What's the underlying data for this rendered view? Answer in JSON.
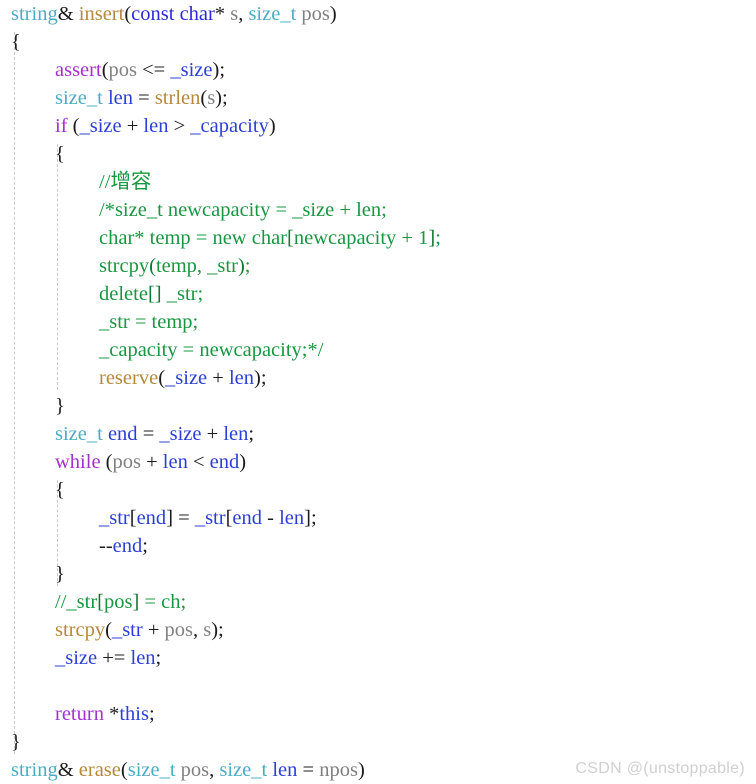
{
  "editor": {
    "language": "cpp",
    "background": "#ffffff",
    "indent_guide_color": "#c9c9c9",
    "font_size_px": 20.5,
    "line_height_px": 28
  },
  "palette": {
    "plain": "#1c1c1c",
    "type": "#4bacc6",
    "keyword": "#2b2bd6",
    "control": "#a331cf",
    "function": "#b5893d",
    "variable": "#2b3fd6",
    "parameter": "#808080",
    "comment": "#1a9641",
    "watermark": "#d0d0d0"
  },
  "watermark": {
    "text": "CSDN @(unstoppable)"
  },
  "code": {
    "lines": [
      {
        "n": 1,
        "tokens": [
          {
            "t": "string",
            "c": "type"
          },
          {
            "t": "& ",
            "c": "plain"
          },
          {
            "t": "insert",
            "c": "fn"
          },
          {
            "t": "(",
            "c": "punct"
          },
          {
            "t": "const ",
            "c": "kw"
          },
          {
            "t": "char",
            "c": "kw"
          },
          {
            "t": "* ",
            "c": "plain"
          },
          {
            "t": "s",
            "c": "param"
          },
          {
            "t": ", ",
            "c": "plain"
          },
          {
            "t": "size_t ",
            "c": "type"
          },
          {
            "t": "pos",
            "c": "param"
          },
          {
            "t": ")",
            "c": "punct"
          }
        ]
      },
      {
        "n": 2,
        "tokens": [
          {
            "t": "{",
            "c": "punct"
          }
        ]
      },
      {
        "n": 3,
        "tokens": [
          {
            "t": "\tassert",
            "c": "ctrl",
            "indent": 1
          },
          {
            "t": "(",
            "c": "punct"
          },
          {
            "t": "pos",
            "c": "param"
          },
          {
            "t": " <= ",
            "c": "plain"
          },
          {
            "t": "_size",
            "c": "var"
          },
          {
            "t": ");",
            "c": "punct"
          }
        ]
      },
      {
        "n": 4,
        "tokens": [
          {
            "t": "size_t ",
            "c": "type"
          },
          {
            "t": "len",
            "c": "var"
          },
          {
            "t": " = ",
            "c": "plain"
          },
          {
            "t": "strlen",
            "c": "fn"
          },
          {
            "t": "(",
            "c": "punct"
          },
          {
            "t": "s",
            "c": "param"
          },
          {
            "t": ");",
            "c": "punct"
          }
        ]
      },
      {
        "n": 5,
        "tokens": [
          {
            "t": "if",
            "c": "ctrl"
          },
          {
            "t": " (",
            "c": "punct"
          },
          {
            "t": "_size",
            "c": "var"
          },
          {
            "t": " + ",
            "c": "plain"
          },
          {
            "t": "len",
            "c": "var"
          },
          {
            "t": " > ",
            "c": "plain"
          },
          {
            "t": "_capacity",
            "c": "var"
          },
          {
            "t": ")",
            "c": "punct"
          }
        ]
      },
      {
        "n": 6,
        "tokens": [
          {
            "t": "{",
            "c": "punct"
          }
        ]
      },
      {
        "n": 7,
        "tokens": [
          {
            "t": "//增容",
            "c": "comment"
          }
        ]
      },
      {
        "n": 8,
        "tokens": [
          {
            "t": "/*size_t newcapacity = _size + len;",
            "c": "comment"
          }
        ]
      },
      {
        "n": 9,
        "tokens": [
          {
            "t": "char* temp = new char",
            "c": "comment"
          },
          {
            "t": "[",
            "c": "commentb"
          },
          {
            "t": "newcapacity + 1",
            "c": "comment"
          },
          {
            "t": "]",
            "c": "commentb"
          },
          {
            "t": ";",
            "c": "comment"
          }
        ]
      },
      {
        "n": 10,
        "tokens": [
          {
            "t": "strcpy",
            "c": "comment"
          },
          {
            "t": "(",
            "c": "commentb"
          },
          {
            "t": "temp, _str",
            "c": "comment"
          },
          {
            "t": ")",
            "c": "commentb"
          },
          {
            "t": ";",
            "c": "comment"
          }
        ]
      },
      {
        "n": 11,
        "tokens": [
          {
            "t": "delete",
            "c": "comment"
          },
          {
            "t": "[]",
            "c": "commentb"
          },
          {
            "t": " _str;",
            "c": "comment"
          }
        ]
      },
      {
        "n": 12,
        "tokens": [
          {
            "t": "_str = temp;",
            "c": "comment"
          }
        ]
      },
      {
        "n": 13,
        "tokens": [
          {
            "t": "_capacity = newcapacity;*/",
            "c": "comment"
          }
        ]
      },
      {
        "n": 14,
        "tokens": [
          {
            "t": "reserve",
            "c": "fn"
          },
          {
            "t": "(",
            "c": "punct"
          },
          {
            "t": "_size",
            "c": "var"
          },
          {
            "t": " + ",
            "c": "plain"
          },
          {
            "t": "len",
            "c": "var"
          },
          {
            "t": ");",
            "c": "punct"
          }
        ]
      },
      {
        "n": 15,
        "tokens": [
          {
            "t": "}",
            "c": "punct"
          }
        ]
      },
      {
        "n": 16,
        "tokens": [
          {
            "t": "size_t ",
            "c": "type"
          },
          {
            "t": "end",
            "c": "var"
          },
          {
            "t": " = ",
            "c": "plain"
          },
          {
            "t": "_size",
            "c": "var"
          },
          {
            "t": " + ",
            "c": "plain"
          },
          {
            "t": "len",
            "c": "var"
          },
          {
            "t": ";",
            "c": "punct"
          }
        ]
      },
      {
        "n": 17,
        "tokens": [
          {
            "t": "while",
            "c": "ctrl"
          },
          {
            "t": " (",
            "c": "punct"
          },
          {
            "t": "pos",
            "c": "param"
          },
          {
            "t": " + ",
            "c": "plain"
          },
          {
            "t": "len",
            "c": "var"
          },
          {
            "t": " < ",
            "c": "plain"
          },
          {
            "t": "end",
            "c": "var"
          },
          {
            "t": ")",
            "c": "punct"
          }
        ]
      },
      {
        "n": 18,
        "tokens": [
          {
            "t": "{",
            "c": "punct"
          }
        ]
      },
      {
        "n": 19,
        "tokens": [
          {
            "t": "_str",
            "c": "var"
          },
          {
            "t": "[",
            "c": "punct"
          },
          {
            "t": "end",
            "c": "var"
          },
          {
            "t": "] = ",
            "c": "punct"
          },
          {
            "t": "_str",
            "c": "var"
          },
          {
            "t": "[",
            "c": "punct"
          },
          {
            "t": "end",
            "c": "var"
          },
          {
            "t": " - ",
            "c": "plain"
          },
          {
            "t": "len",
            "c": "var"
          },
          {
            "t": "];",
            "c": "punct"
          }
        ]
      },
      {
        "n": 20,
        "tokens": [
          {
            "t": "--",
            "c": "plain"
          },
          {
            "t": "end",
            "c": "var"
          },
          {
            "t": ";",
            "c": "punct"
          }
        ]
      },
      {
        "n": 21,
        "tokens": [
          {
            "t": "}",
            "c": "punct"
          }
        ]
      },
      {
        "n": 22,
        "tokens": [
          {
            "t": "//",
            "c": "comment"
          },
          {
            "t": "_str",
            "c": "comment"
          },
          {
            "t": "[",
            "c": "commentb"
          },
          {
            "t": "pos",
            "c": "comment"
          },
          {
            "t": "]",
            "c": "commentb"
          },
          {
            "t": " = ch;",
            "c": "comment"
          }
        ]
      },
      {
        "n": 23,
        "tokens": [
          {
            "t": "strcpy",
            "c": "fn"
          },
          {
            "t": "(",
            "c": "punct"
          },
          {
            "t": "_str",
            "c": "var"
          },
          {
            "t": " + ",
            "c": "plain"
          },
          {
            "t": "pos",
            "c": "param"
          },
          {
            "t": ", ",
            "c": "plain"
          },
          {
            "t": "s",
            "c": "param"
          },
          {
            "t": ");",
            "c": "punct"
          }
        ]
      },
      {
        "n": 24,
        "tokens": [
          {
            "t": "_size",
            "c": "var"
          },
          {
            "t": " += ",
            "c": "plain"
          },
          {
            "t": "len",
            "c": "var"
          },
          {
            "t": ";",
            "c": "punct"
          }
        ]
      },
      {
        "n": 25,
        "tokens": []
      },
      {
        "n": 26,
        "tokens": [
          {
            "t": "return",
            "c": "ctrl"
          },
          {
            "t": " *",
            "c": "plain"
          },
          {
            "t": "this",
            "c": "var"
          },
          {
            "t": ";",
            "c": "punct"
          }
        ]
      },
      {
        "n": 27,
        "tokens": [
          {
            "t": "}",
            "c": "punct"
          }
        ]
      },
      {
        "n": 28,
        "tokens": [
          {
            "t": "string",
            "c": "type"
          },
          {
            "t": "& ",
            "c": "plain"
          },
          {
            "t": "erase",
            "c": "fn"
          },
          {
            "t": "(",
            "c": "punct"
          },
          {
            "t": "size_t ",
            "c": "type"
          },
          {
            "t": "pos",
            "c": "param"
          },
          {
            "t": ", ",
            "c": "plain"
          },
          {
            "t": "size_t ",
            "c": "type"
          },
          {
            "t": "len",
            "c": "var"
          },
          {
            "t": " = ",
            "c": "plain"
          },
          {
            "t": "npos",
            "c": "param"
          },
          {
            "t": ")",
            "c": "punct"
          }
        ]
      }
    ],
    "indents": [
      0,
      0,
      1,
      1,
      1,
      1,
      2,
      2,
      2,
      2,
      2,
      2,
      2,
      2,
      1,
      1,
      1,
      1,
      2,
      2,
      1,
      1,
      1,
      1,
      1,
      1,
      0,
      0
    ],
    "guides": [
      {
        "x": 14,
        "from_line": 2,
        "to_line": 27
      },
      {
        "x": 57,
        "from_line": 6,
        "to_line": 14
      },
      {
        "x": 57,
        "from_line": 18,
        "to_line": 21
      }
    ]
  }
}
